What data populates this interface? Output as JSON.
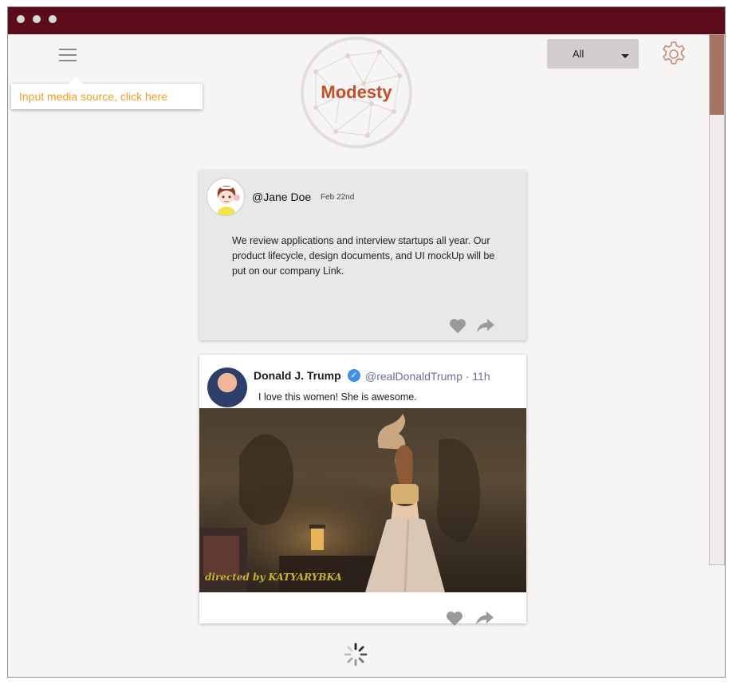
{
  "window": {
    "titlebar_color": "#5c0b1b"
  },
  "header": {
    "logo_text": "Modesty",
    "tooltip": "Input media source, click here",
    "filter_value": "All"
  },
  "feed": {
    "posts": [
      {
        "handle": "@Jane Doe",
        "date": "Feb 22nd",
        "text": "We review applications and interview startups all year. Our product lifecycle, design documents, and UI mockUp will be put on our company Link."
      },
      {
        "author": "Donald J. Trump",
        "verified_icon": "check-badge-icon",
        "handle_time": "@realDonaldTrump · 11h",
        "text": "I love this women! She is awesome.",
        "photo_credit": "directed by KATYARYBKA"
      }
    ]
  },
  "colors": {
    "accent": "#c1502a",
    "tooltip_text": "#f0a020",
    "scroll_thumb": "#a87264",
    "verified": "#3d91e6"
  }
}
